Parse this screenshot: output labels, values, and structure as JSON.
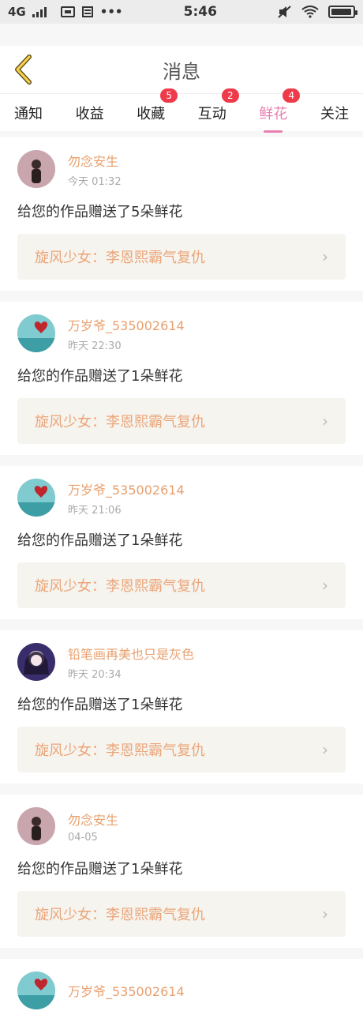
{
  "status": {
    "network": "4G",
    "signal_icon": "signal-icon",
    "time": "5:46",
    "battery_level": 0.95
  },
  "header": {
    "title": "消息"
  },
  "tabs": [
    {
      "label": "通知",
      "badge": null,
      "active": false
    },
    {
      "label": "收益",
      "badge": null,
      "active": false
    },
    {
      "label": "收藏",
      "badge": "5",
      "active": false
    },
    {
      "label": "互动",
      "badge": "2",
      "active": false
    },
    {
      "label": "鲜花",
      "badge": "4",
      "active": true
    },
    {
      "label": "关注",
      "badge": null,
      "active": false
    }
  ],
  "messages": [
    {
      "user": "勿念安生",
      "time": "今天 01:32",
      "text": "给您的作品赠送了5朵鲜花",
      "work": "旋风少女：李恩熙霸气复仇"
    },
    {
      "user": "万岁爷_535002614",
      "time": "昨天 22:30",
      "text": "给您的作品赠送了1朵鲜花",
      "work": "旋风少女：李恩熙霸气复仇"
    },
    {
      "user": "万岁爷_535002614",
      "time": "昨天 21:06",
      "text": "给您的作品赠送了1朵鲜花",
      "work": "旋风少女：李恩熙霸气复仇"
    },
    {
      "user": "铅笔画再美也只是灰色",
      "time": "昨天 20:34",
      "text": "给您的作品赠送了1朵鲜花",
      "work": "旋风少女：李恩熙霸气复仇"
    },
    {
      "user": "勿念安生",
      "time": "04-05",
      "text": "给您的作品赠送了1朵鲜花",
      "work": "旋风少女：李恩熙霸气复仇"
    },
    {
      "user": "万岁爷_535002614",
      "time": "",
      "text": "",
      "work": ""
    }
  ],
  "colors": {
    "accent_pink": "#e77fb0",
    "username_orange": "#e8a06e",
    "badge_red": "#ef3a4a"
  }
}
